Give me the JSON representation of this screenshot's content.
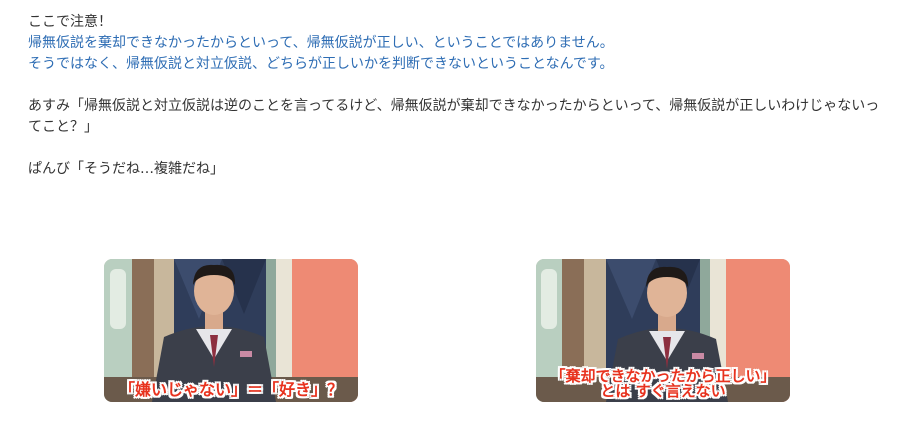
{
  "article": {
    "heading": "ここで注意！",
    "blue_line_1": "帰無仮説を棄却できなかったからといって、帰無仮説が正しい、ということではありません。",
    "blue_line_2": "そうではなく、帰無仮説と対立仮説、どちらが正しいかを判断できないということなんです。",
    "asumi_quote": "あすみ「帰無仮説と対立仮説は逆のことを言ってるけど、帰無仮説が棄却できなかったからといって、帰無仮説が正しいわけじゃないってこと？」",
    "panbi_quote": "ぱんび「そうだね…複雑だね」"
  },
  "figures": [
    {
      "caption_lines": [
        "「嫌いじゃない」＝「好き」？"
      ]
    },
    {
      "caption_lines": [
        "「棄却できなかったから正しい」",
        "とは すぐ言えない"
      ]
    }
  ],
  "colors": {
    "text": "#333333",
    "emphasis_blue": "#2e6db4",
    "caption_red": "#e8321e",
    "studio_salmon": "#ee8a74",
    "studio_navy": "#2f3d5a"
  }
}
